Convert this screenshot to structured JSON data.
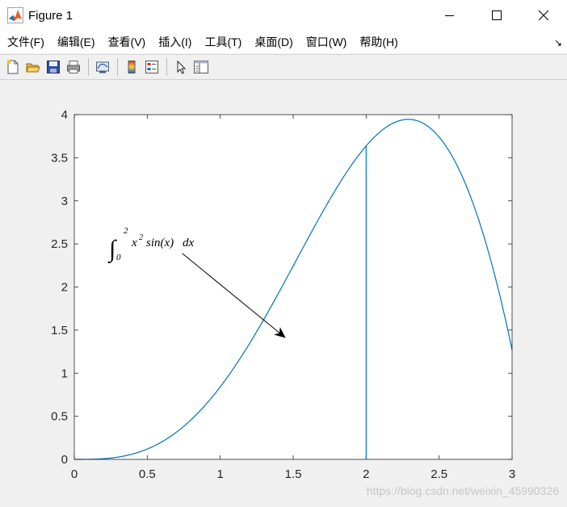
{
  "window": {
    "title": "Figure 1",
    "icon": "matlab-icon",
    "controls": [
      "minimize-icon",
      "maximize-icon",
      "close-icon"
    ]
  },
  "menu": {
    "items": [
      "文件(F)",
      "编辑(E)",
      "查看(V)",
      "插入(I)",
      "工具(T)",
      "桌面(D)",
      "窗口(W)",
      "帮助(H)"
    ],
    "corner_glyph": "↘"
  },
  "toolbar": {
    "buttons": [
      "new-figure-icon",
      "open-file-icon",
      "save-icon",
      "print-icon",
      "link-plot-icon",
      "insert-colorbar-icon",
      "insert-legend-icon",
      "edit-plot-arrow-icon",
      "property-inspector-icon"
    ]
  },
  "chart_data": {
    "type": "line",
    "function": "x^2 sin(x)",
    "xlim": [
      0,
      3
    ],
    "ylim": [
      0,
      4
    ],
    "xticks": [
      0,
      0.5,
      1,
      1.5,
      2,
      2.5,
      3
    ],
    "xtick_labels": [
      "0",
      "0.5",
      "1",
      "1.5",
      "2",
      "2.5",
      "3"
    ],
    "yticks": [
      0,
      0.5,
      1,
      1.5,
      2,
      2.5,
      3,
      3.5,
      4
    ],
    "ytick_labels": [
      "0",
      "0.5",
      "1",
      "1.5",
      "2",
      "2.5",
      "3",
      "3.5",
      "4"
    ],
    "series": [
      {
        "color": "#0072bd",
        "x": [
          0,
          0.1,
          0.2,
          0.3,
          0.4,
          0.5,
          0.6,
          0.7,
          0.8,
          0.9,
          1.0,
          1.1,
          1.2,
          1.3,
          1.4,
          1.5,
          1.6,
          1.7,
          1.8,
          1.9,
          2.0,
          2.1,
          2.2,
          2.3,
          2.4,
          2.5,
          2.6,
          2.7,
          2.8,
          2.9,
          3.0
        ],
        "y": [
          0,
          0.001,
          0.008,
          0.027,
          0.062,
          0.12,
          0.203,
          0.316,
          0.459,
          0.635,
          0.841,
          1.078,
          1.342,
          1.629,
          1.931,
          2.244,
          2.559,
          2.865,
          3.155,
          3.415,
          3.637,
          3.807,
          3.915,
          3.949,
          3.897,
          3.74,
          3.489,
          3.135,
          2.629,
          1.968,
          1.27
        ]
      }
    ],
    "vertical_line": {
      "x": 2,
      "y_from": 0,
      "y_to": 3.637,
      "color": "#0072bd"
    },
    "annotation": {
      "text": "∫₀² x² sin(x) dx",
      "integrand": "x",
      "integrand_exp": "2",
      "func": "sin(x)",
      "dx": "dx",
      "lower": "0",
      "upper": "2",
      "arrow_from": [
        0.74,
        2.39
      ],
      "arrow_to": [
        1.44,
        1.42
      ]
    },
    "grid": false,
    "box": true
  },
  "watermark": "https://blog.csdn.net/weixin_45990326"
}
